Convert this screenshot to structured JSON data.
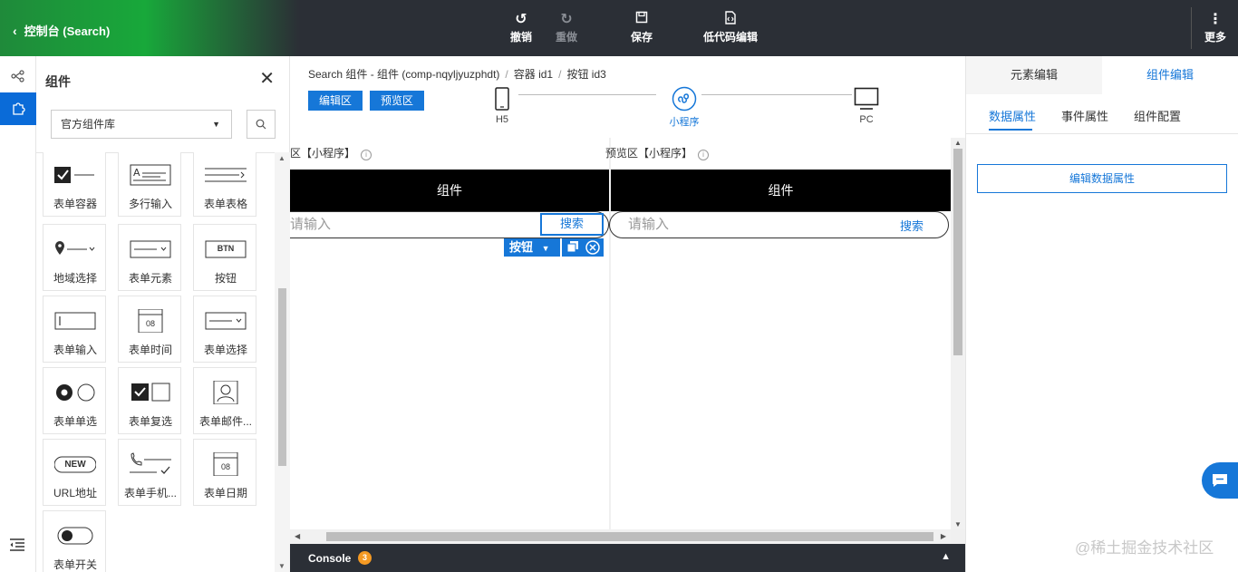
{
  "topbar": {
    "back_label": "控制台 (Search)",
    "undo": "撤销",
    "redo": "重做",
    "save": "保存",
    "lowcode": "低代码编辑",
    "more": "更多"
  },
  "panel": {
    "title": "组件",
    "library_select": "官方组件库",
    "components": [
      {
        "label": "表单容器",
        "icon": "form-container-icon"
      },
      {
        "label": "多行输入",
        "icon": "textarea-icon"
      },
      {
        "label": "表单表格",
        "icon": "form-table-icon"
      },
      {
        "label": "地域选择",
        "icon": "region-select-icon"
      },
      {
        "label": "表单元素",
        "icon": "form-element-icon"
      },
      {
        "label": "按钮",
        "icon": "button-icon"
      },
      {
        "label": "表单输入",
        "icon": "form-input-icon"
      },
      {
        "label": "表单时间",
        "icon": "form-time-icon"
      },
      {
        "label": "表单选择",
        "icon": "form-select-icon"
      },
      {
        "label": "表单单选",
        "icon": "radio-icon"
      },
      {
        "label": "表单复选",
        "icon": "checkbox-icon"
      },
      {
        "label": "表单邮件...",
        "icon": "email-icon"
      },
      {
        "label": "URL地址",
        "icon": "url-icon"
      },
      {
        "label": "表单手机...",
        "icon": "phone-icon"
      },
      {
        "label": "表单日期",
        "icon": "date-icon"
      },
      {
        "label": "表单开关",
        "icon": "switch-icon"
      }
    ],
    "thumb_btn": "BTN",
    "thumb_new": "NEW",
    "thumb_cal": "08"
  },
  "breadcrumb": {
    "root": "Search 组件 - 组件 (comp-nqyljyuzphdt)",
    "container": "容器 id1",
    "button": "按钮 id3"
  },
  "zones": {
    "edit": "编辑区",
    "preview": "预览区"
  },
  "devices": {
    "h5": "H5",
    "miniapp": "小程序",
    "pc": "PC"
  },
  "canvas": {
    "edit_label": "区【小程序】",
    "preview_label": "预览区【小程序】",
    "navbar_title": "组件",
    "search_placeholder": "请输入",
    "search_button": "搜索",
    "toolbar_label": "按钮"
  },
  "console": {
    "title": "Console",
    "badge": "3"
  },
  "right": {
    "tab_element": "元素编辑",
    "tab_component": "组件编辑",
    "sub_data": "数据属性",
    "sub_event": "事件属性",
    "sub_config": "组件配置",
    "edit_button": "编辑数据属性"
  },
  "watermark": "@稀土掘金技术社区",
  "colors": {
    "accent": "#1677d8",
    "topbar": "#2b2f36",
    "brand_green": "#18a83a",
    "badge": "#f59a23"
  }
}
